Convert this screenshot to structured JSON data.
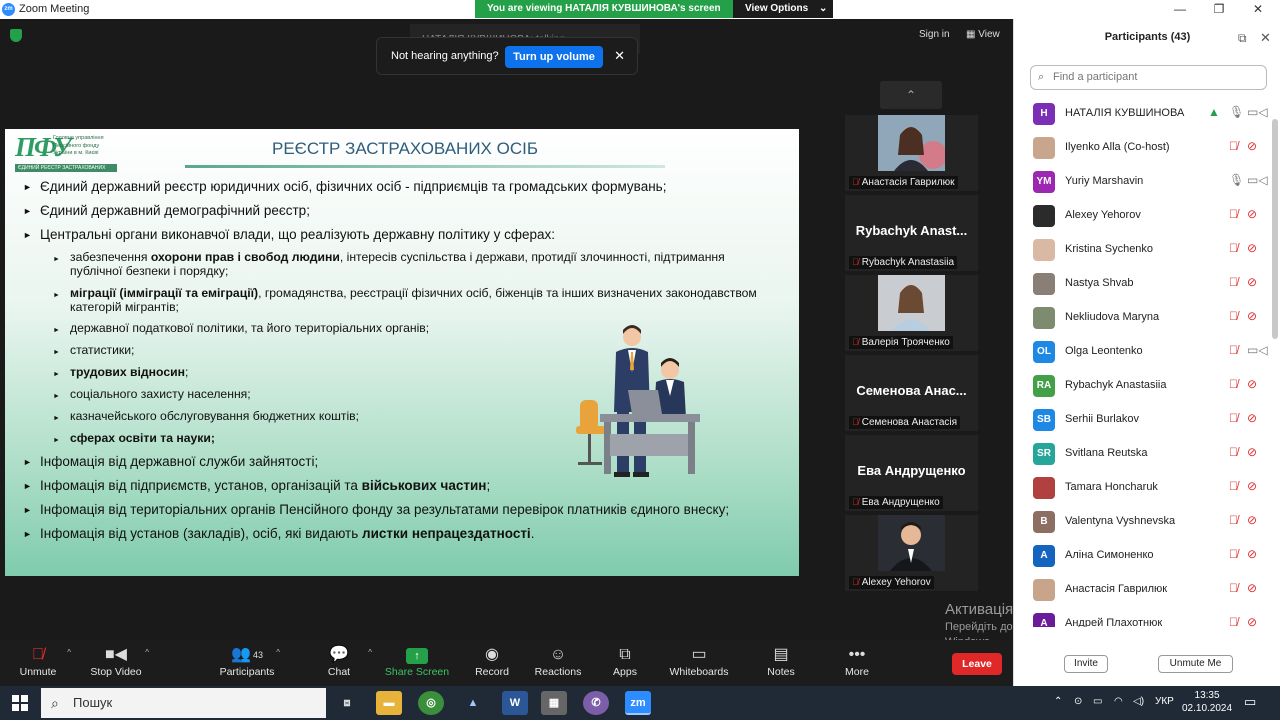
{
  "window": {
    "title": "Zoom Meeting",
    "logo": "zm",
    "controls": [
      "minimize-icon",
      "maximize-icon",
      "close-icon"
    ]
  },
  "banner": {
    "text": "You are viewing НАТАЛІЯ КУВШИНОВА's screen",
    "options_label": "View Options",
    "color": "#24a148"
  },
  "meeting": {
    "talking_text": "НАТАЛІЯ КУВШИНОВА: talking",
    "notice": {
      "message": "Not hearing anything?",
      "button": "Turn up volume"
    },
    "sign_in": "Sign in",
    "view": "View"
  },
  "slide": {
    "logo_big": "ПФУ",
    "logo_lines": [
      "Головне управління",
      "Пенсійного фонду",
      "України в м. Києві"
    ],
    "logo_strip": "ЄДИНИЙ РЕЄСТР ЗАСТРАХОВАНИХ ОСІБ",
    "title": "РЕЄСТР ЗАСТРАХОВАНИХ ОСІБ",
    "l1_a": "Єдиний державний реєстр юридичних осіб, фізичних осіб - підприємців та громадських формувань;",
    "l1_b": "Єдиний державний демографічний реєстр;",
    "l1_c": "Центральні органи виконавчої влади, що реалізують державну політику у сферах:",
    "s1_pre": "забезпечення ",
    "s1_bold": "охорони прав і свобод людини",
    "s1_post": ", інтересів суспільства і держави, протидії злочинності, підтримання публічної безпеки і порядку;",
    "s2_bold": "міграції (імміграції та еміграції)",
    "s2_post": ", громадянства, реєстрації фізичних осіб, біженців та інших визначених законодавством категорій мігрантів;",
    "s3": "державної податкової політики, та його територіальних органів;",
    "s4": "статистики;",
    "s5": "трудових відносин",
    "s5_tail": ";",
    "s6": "соціального захисту населення;",
    "s7": "казначейського обслуговування бюджетних коштів;",
    "s8": "сферах освіти та науки;",
    "l2_a": "Інфомація від державної служби зайнятості;",
    "l2_b_pre": "Інфомація від підприємств, установ, організацій та ",
    "l2_b_bold": "військових частин",
    "l2_b_tail": ";",
    "l2_c": "Інфомація від територіальних органів Пенсійного фонду за результатами перевірок платників єдиного внеску;",
    "l2_d_pre": "Інфомація від установ (закладів), осіб, які видають ",
    "l2_d_bold": "листки непрацездатності",
    "l2_d_tail": "."
  },
  "video_tiles": [
    {
      "name": "Анастасія Гаврилюк",
      "has_photo": true
    },
    {
      "name": "Rybachyk Anastasiia",
      "big": "Rybachyk Anast..."
    },
    {
      "name": "Валерія Трояченко",
      "has_photo": true
    },
    {
      "name": "Семенова Анастасія",
      "big": "Семенова Анас..."
    },
    {
      "name": "Ева Андрущенко",
      "big": "Ева Андрущенко"
    },
    {
      "name": "Alexey Yehorov",
      "has_photo": true
    }
  ],
  "activation": {
    "heading": "Активація Windows",
    "sub": "Перейдіть до розділу \"Настройки\", щоб активувати Windows."
  },
  "toolbar": {
    "unmute": "Unmute",
    "stop_video": "Stop Video",
    "participants": "Participants",
    "participants_count": "43",
    "chat": "Chat",
    "share": "Share Screen",
    "record": "Record",
    "reactions": "Reactions",
    "apps": "Apps",
    "whiteboards": "Whiteboards",
    "notes": "Notes",
    "more": "More",
    "leave": "Leave"
  },
  "panel": {
    "title": "Participants (43)",
    "search_placeholder": "Find a participant",
    "invite": "Invite",
    "unmute_me": "Unmute Me",
    "participants": [
      {
        "name": "НАТАЛІЯ КУВШИНОВА",
        "initial": "Н",
        "color": "#7a2fb5",
        "mic": "on",
        "cam": "on",
        "sharing": true
      },
      {
        "name": "Ilyenko Alla (Co-host)",
        "initial": "",
        "color": "#c8a68e",
        "mic": "off",
        "cam": "off"
      },
      {
        "name": "Yuriy Marshavin",
        "initial": "YM",
        "color": "#9c27b0",
        "mic": "on",
        "cam": "on"
      },
      {
        "name": "Alexey Yehorov",
        "initial": "",
        "color": "#2b2b2b",
        "mic": "off",
        "cam": "off"
      },
      {
        "name": "Kristina Sychenko",
        "initial": "",
        "color": "#d9b9a4",
        "mic": "off",
        "cam": "off"
      },
      {
        "name": "Nastya Shvab",
        "initial": "",
        "color": "#8a7f76",
        "mic": "off",
        "cam": "off"
      },
      {
        "name": "Nekliudova Maryna",
        "initial": "",
        "color": "#7d8b6e",
        "mic": "off",
        "cam": "off"
      },
      {
        "name": "Olga Leontenko",
        "initial": "OL",
        "color": "#1e88e5",
        "mic": "off",
        "cam": "on"
      },
      {
        "name": "Rybachyk Anastasiia",
        "initial": "RA",
        "color": "#43a047",
        "mic": "off",
        "cam": "off"
      },
      {
        "name": "Serhii Burlakov",
        "initial": "SB",
        "color": "#1e88e5",
        "mic": "off",
        "cam": "off"
      },
      {
        "name": "Svitlana Reutska",
        "initial": "SR",
        "color": "#26a69a",
        "mic": "off",
        "cam": "off"
      },
      {
        "name": "Tamara Honcharuk",
        "initial": "",
        "color": "#b0413e",
        "mic": "off",
        "cam": "off"
      },
      {
        "name": "Valentyna Vyshnevska",
        "initial": "В",
        "color": "#8d6e63",
        "mic": "off",
        "cam": "off"
      },
      {
        "name": "Аліна Симоненко",
        "initial": "А",
        "color": "#1565c0",
        "mic": "off",
        "cam": "off"
      },
      {
        "name": "Анастасія Гаврилюк",
        "initial": "",
        "color": "#c7a48a",
        "mic": "off",
        "cam": "off"
      },
      {
        "name": "Андрей Плахотнюк",
        "initial": "А",
        "color": "#6a1b9a",
        "mic": "off",
        "cam": "off"
      }
    ]
  },
  "taskbar": {
    "search": "Пошук",
    "lang": "УКР",
    "time": "13:35",
    "date": "02.10.2024"
  }
}
